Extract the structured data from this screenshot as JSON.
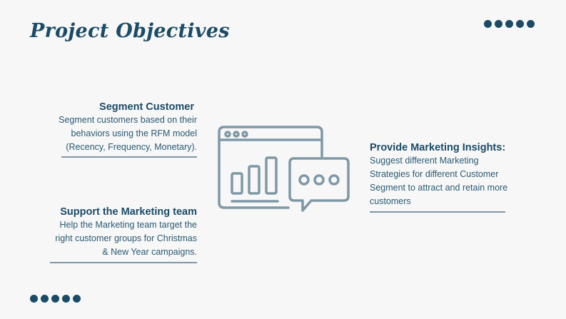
{
  "title": "Project Objectives",
  "objectives": {
    "segment": {
      "heading": "Segment Customer",
      "lines": [
        "Segment customers based on their",
        "behaviors using the RFM model",
        "(Recency, Frequency, Monetary)."
      ]
    },
    "support": {
      "heading": "Support the Marketing team",
      "lines": [
        "Help the Marketing team target the",
        "right customer groups for Christmas",
        "& New Year campaigns."
      ]
    },
    "insights": {
      "heading": "Provide Marketing Insights:",
      "lines": [
        "Suggest different Marketing",
        "Strategies for different Customer",
        "Segment to attract and retain more",
        "customers"
      ]
    }
  },
  "colors": {
    "heading": "#1b4b66",
    "body_text": "#2a5a73",
    "divider": "#7f98a6",
    "icon_stroke": "#7f98a6",
    "background": "#f7f7f7"
  },
  "icons": {
    "illustration": "browser-window-bar-chart-chat-bubble-icon"
  }
}
